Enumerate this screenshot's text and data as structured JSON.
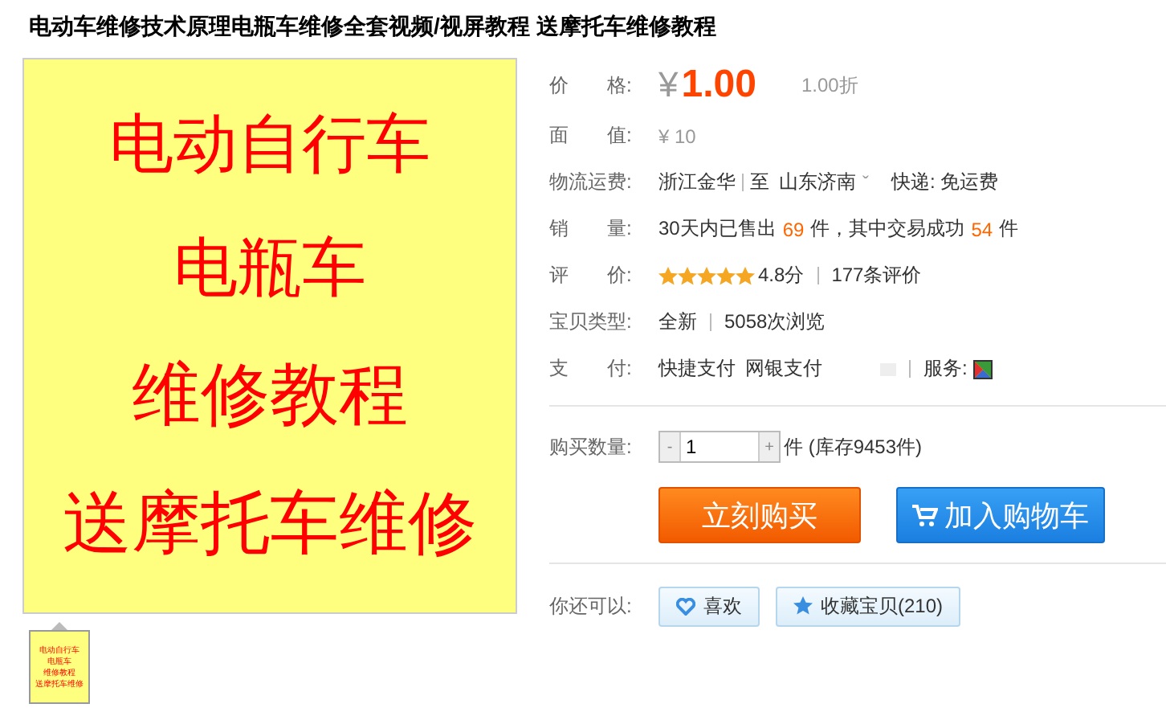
{
  "title": "电动车维修技术原理电瓶车维修全套视频/视屏教程 送摩托车维修教程",
  "product_image": {
    "lines": [
      "电动自行车",
      "电瓶车",
      "维修教程",
      "送摩托车维修"
    ]
  },
  "thumbnails": [
    {
      "lines": [
        "电动自行车",
        "电瓶车",
        "维修教程",
        "送摩托车维修"
      ],
      "selected": true
    }
  ],
  "price": {
    "label": "价　　格:",
    "currency": "¥",
    "value": "1.00",
    "discount": "1.00折"
  },
  "face_value": {
    "label": "面　　值:",
    "value": "¥ 10"
  },
  "logistics": {
    "label": "物流运费:",
    "from": "浙江金华",
    "to_label": "至",
    "to": "山东济南",
    "caret": "ˇ",
    "shipping": "快递: 免运费"
  },
  "sales": {
    "label": "销　　量:",
    "prefix": "30天内已售出",
    "sold": "69",
    "middle": "件，其中交易成功",
    "success": "54",
    "suffix": "件"
  },
  "rating": {
    "label": "评　　价:",
    "stars": 5,
    "score": "4.8分",
    "reviews": "177条评价"
  },
  "item_type": {
    "label": "宝贝类型:",
    "condition": "全新",
    "views": "5058次浏览"
  },
  "payment": {
    "label": "支　　付:",
    "methods": [
      "快捷支付",
      "网银支付"
    ],
    "service_label": "服务:"
  },
  "quantity": {
    "label": "购买数量:",
    "minus": "-",
    "value": "1",
    "plus": "+",
    "stock": "件 (库存9453件)"
  },
  "buttons": [
    {
      "kind": "buy",
      "label": "立刻购买"
    },
    {
      "kind": "cart",
      "label": "加入购物车"
    }
  ],
  "more": {
    "label": "你还可以:",
    "actions": [
      {
        "kind": "like",
        "label": "喜欢"
      },
      {
        "kind": "favorite",
        "label": "收藏宝贝(210)"
      }
    ]
  }
}
